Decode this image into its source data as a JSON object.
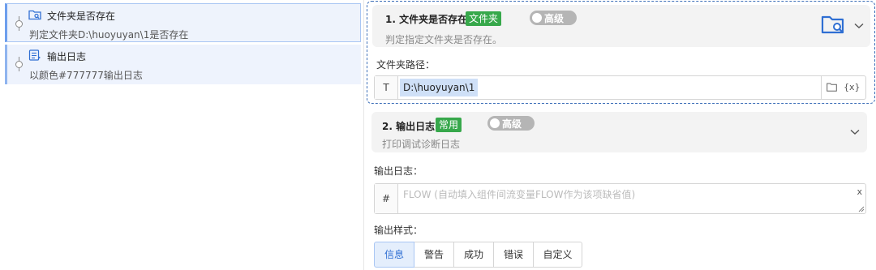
{
  "flow": {
    "items": [
      {
        "title": "文件夹是否存在",
        "desc": "判定文件夹D:\\huoyuyan\\1是否存在"
      },
      {
        "title": "输出日志",
        "desc": "以颜色#777777输出日志"
      }
    ]
  },
  "step1": {
    "title": "1. 文件夹是否存在",
    "tag": "文件夹",
    "toggle_label": "高级",
    "subtitle": "判定指定文件夹是否存在。",
    "field_label": "文件夹路径：",
    "path_prefix": "T",
    "path_value": "D:\\huoyuyan\\1",
    "var_button": "{x}"
  },
  "step2": {
    "title": "2. 输出日志",
    "tag": "常用",
    "toggle_label": "高级",
    "subtitle": "打印调试诊断日志",
    "log_label": "输出日志：",
    "log_prefix": "#",
    "log_placeholder": "FLOW (自动填入组件间流变量FLOW作为该项缺省值)",
    "log_clear": "x",
    "style_label": "输出样式：",
    "style_options": [
      "信息",
      "警告",
      "成功",
      "错误",
      "自定义"
    ],
    "style_selected": "信息"
  },
  "colors": {
    "accent": "#2f6fd3",
    "tag_green": "#37a84b",
    "selection": "#eef3fc",
    "toggle_off": "#b5b5b5"
  }
}
